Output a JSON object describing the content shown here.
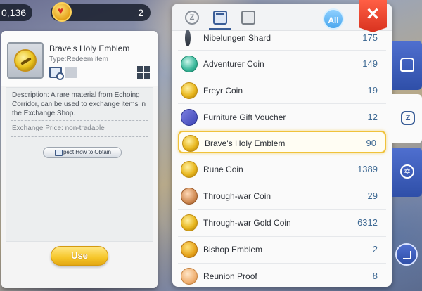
{
  "hud": {
    "coins": "0,136",
    "gold": "2"
  },
  "detail": {
    "item_name": "Brave's Holy Emblem",
    "item_type": "Type:Redeem item",
    "description": "Description: A rare material from Echoing Corridor, can be used to exchange items in the Exchange Shop.",
    "exchange_price": "Exchange Price: non-tradable",
    "inspect_button": "Inspect How to Obtain",
    "use_button": "Use"
  },
  "list": {
    "all_label": "All",
    "rows": [
      {
        "name": "Nibelungen Shard",
        "qty": "175",
        "icon": "shard-icon"
      },
      {
        "name": "Adventurer Coin",
        "qty": "149",
        "icon": "adventurer-coin-icon"
      },
      {
        "name": "Freyr Coin",
        "qty": "19",
        "icon": "freyr-coin-icon"
      },
      {
        "name": "Furniture Gift Voucher",
        "qty": "12",
        "icon": "voucher-icon"
      },
      {
        "name": "Brave's Holy Emblem",
        "qty": "90",
        "icon": "emblem-icon"
      },
      {
        "name": "Rune Coin",
        "qty": "1389",
        "icon": "rune-coin-icon"
      },
      {
        "name": "Through-war Coin",
        "qty": "29",
        "icon": "through-war-coin-icon"
      },
      {
        "name": "Through-war Gold Coin",
        "qty": "6312",
        "icon": "through-war-gold-coin-icon"
      },
      {
        "name": "Bishop Emblem",
        "qty": "2",
        "icon": "bishop-emblem-icon"
      },
      {
        "name": "Reunion Proof",
        "qty": "8",
        "icon": "reunion-proof-icon"
      }
    ]
  },
  "close_label": "✕",
  "tabs": {
    "z_label": "Z"
  },
  "colors": {
    "accent": "#3a5d97",
    "selected_border": "#f0c23a",
    "close": "#e0402a",
    "use": "#f6c629"
  }
}
